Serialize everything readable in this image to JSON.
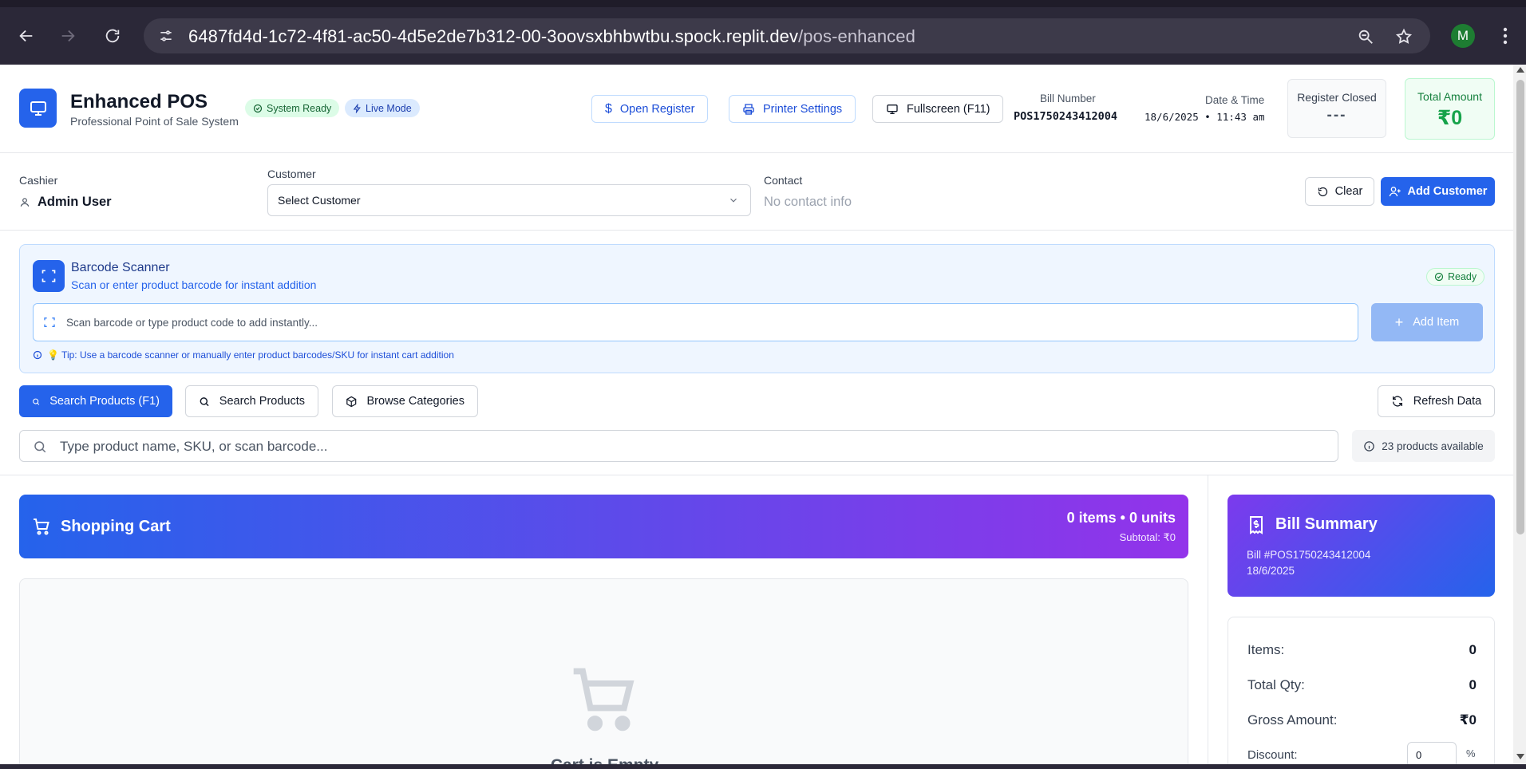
{
  "browser": {
    "url_host": "6487fd4d-1c72-4f81-ac50-4d5e2de7b312-00-3oovsxbhbwtbu.spock.replit.dev",
    "url_path": "/pos-enhanced",
    "profile_initial": "M"
  },
  "header": {
    "title": "Enhanced POS",
    "subtitle": "Professional Point of Sale System",
    "status_system": "System Ready",
    "status_mode": "Live Mode",
    "open_register": "Open Register",
    "printer_settings": "Printer Settings",
    "fullscreen": "Fullscreen (F11)",
    "bill_number_label": "Bill Number",
    "bill_number": "POS1750243412004",
    "datetime_label": "Date & Time",
    "datetime": "18/6/2025 • 11:43 am",
    "register_label": "Register Closed",
    "register_value": "---",
    "total_label": "Total Amount",
    "total_value": "₹0"
  },
  "customer_row": {
    "cashier_label": "Cashier",
    "cashier_name": "Admin User",
    "customer_label": "Customer",
    "customer_selected": "Select Customer",
    "contact_label": "Contact",
    "contact_value": "No contact info",
    "clear": "Clear",
    "add_customer": "Add Customer"
  },
  "scanner": {
    "title": "Barcode Scanner",
    "subtitle": "Scan or enter product barcode for instant addition",
    "status": "Ready",
    "placeholder": "Scan barcode or type product code to add instantly...",
    "add_item": "Add Item",
    "tip": "💡 Tip: Use a barcode scanner or manually enter product barcodes/SKU for instant cart addition"
  },
  "tabs": [
    {
      "label": "Search Products (F1)",
      "active": true
    },
    {
      "label": "Search Products",
      "active": false
    },
    {
      "label": "Browse Categories",
      "active": false
    }
  ],
  "refresh": "Refresh Data",
  "search": {
    "placeholder": "Type product name, SKU, or scan barcode...",
    "available": "23 products available"
  },
  "cart": {
    "title": "Shopping Cart",
    "count": "0 items • 0 units",
    "subtotal": "Subtotal: ₹0",
    "empty_title": "Cart is Empty"
  },
  "bill": {
    "title": "Bill Summary",
    "bill_no": "Bill #POS1750243412004",
    "date": "18/6/2025",
    "rows": [
      {
        "label": "Items:",
        "value": "0"
      },
      {
        "label": "Total Qty:",
        "value": "0"
      },
      {
        "label": "Gross Amount:",
        "value": "₹0"
      }
    ],
    "discount_label": "Discount:",
    "discount_value": "0",
    "discount_unit": "%"
  },
  "colors": {
    "primary": "#2563eb",
    "purple": "#9333ea",
    "success": "#16a34a"
  }
}
